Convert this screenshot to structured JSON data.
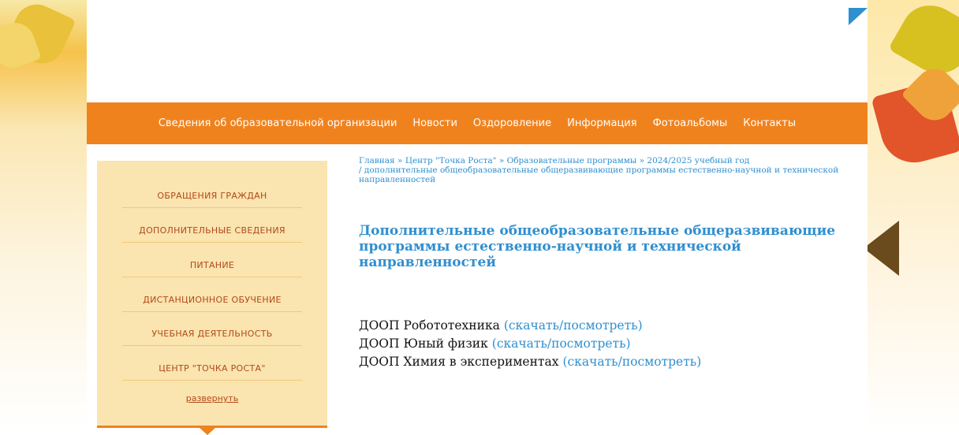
{
  "navbar": {
    "items": [
      "Сведения об образовательной организации",
      "Новости",
      "Оздоровление",
      "Информация",
      "Фотоальбомы",
      "Контакты"
    ]
  },
  "sidebar": {
    "items": [
      "ОБРАЩЕНИЯ ГРАЖДАН",
      "ДОПОЛНИТЕЛЬНЫЕ СВЕДЕНИЯ",
      "ПИТАНИЕ",
      "ДИСТАНЦИОННОЕ ОБУЧЕНИЕ",
      "УЧЕБНАЯ ДЕЯТЕЛЬНОСТЬ",
      "ЦЕНТР \"ТОЧКА РОСТА\""
    ],
    "expand_label": "развернуть"
  },
  "breadcrumb": {
    "items": [
      "Главная",
      "Центр \"Точка Роста\"",
      "Образовательные программы",
      "2024/2025 учебный год"
    ],
    "separator": "»",
    "current_prefix": "/",
    "current": "дополнительные общеобразовательные общеразвивающие программы естественно-научной и технической направленностей"
  },
  "page": {
    "title": "Дополнительные общеобразовательные общеразвивающие программы естественно-научной и технической направленностей"
  },
  "documents": [
    {
      "name": "ДООП Робототехника",
      "link": "(скачать/посмотреть)"
    },
    {
      "name": "ДООП Юный физик",
      "link": "(скачать/посмотреть)"
    },
    {
      "name": "ДООП Химия в экспериментах",
      "link": "(скачать/посмотреть)"
    }
  ],
  "colors": {
    "nav_bg": "#f0821e",
    "sidebar_bg": "#fae4b0",
    "sidebar_text": "#b24a18",
    "link": "#2f8fd0"
  }
}
